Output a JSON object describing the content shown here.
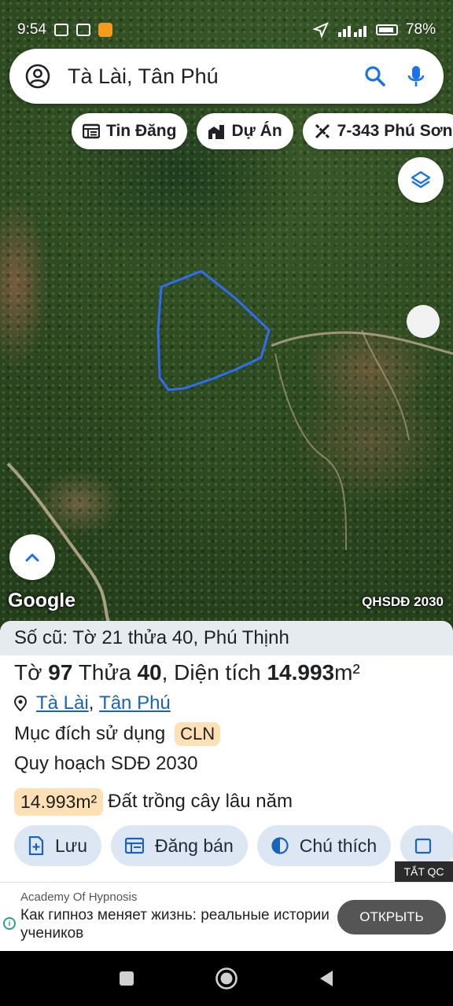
{
  "status_bar": {
    "time": "9:54",
    "battery": "78%"
  },
  "search": {
    "text": "Tà Lài, Tân Phú"
  },
  "chips": [
    {
      "label": "Tin Đăng",
      "icon": "newspaper-icon"
    },
    {
      "label": "Dự Án",
      "icon": "buildings-icon"
    },
    {
      "label": "7-343 Phú Sơn",
      "icon": "ruler-pencil-icon"
    }
  ],
  "map": {
    "provider": "Google",
    "layer_label": "QHSDĐ 2030"
  },
  "panel": {
    "old_info": "Số cũ: Tờ 21 thửa 40, Phú Thịnh",
    "parcel": {
      "sheet_label": "Tờ",
      "sheet": "97",
      "plot_label": "Thửa",
      "plot": "40",
      "area_label": ", Diện tích",
      "area": "14.993",
      "unit": "m²"
    },
    "location": {
      "commune": "Tà Lài",
      "separator": ",",
      "district": "Tân Phú"
    },
    "purpose_label": "Mục đích sử dụng",
    "purpose_code": "CLN",
    "plan_label": "Quy hoạch SDĐ 2030",
    "plan_area": "14.993m²",
    "plan_type": "Đất trồng cây lâu năm",
    "actions": [
      {
        "label": "Lưu",
        "icon": "save-plus-icon"
      },
      {
        "label": "Đăng bán",
        "icon": "listing-icon"
      },
      {
        "label": "Chú thích",
        "icon": "legend-contrast-icon"
      }
    ]
  },
  "ad": {
    "close_label": "TẮT QC",
    "brand": "Academy Of Hypnosis",
    "text": "Как гипноз меняет жизнь: реальные истории учеников",
    "cta": "ОТКРЫТЬ"
  },
  "colors": {
    "accent": "#1a73e8",
    "parcel_outline": "#2f6df2",
    "badge": "#fde0b5",
    "action_bg": "#dde6f3"
  }
}
